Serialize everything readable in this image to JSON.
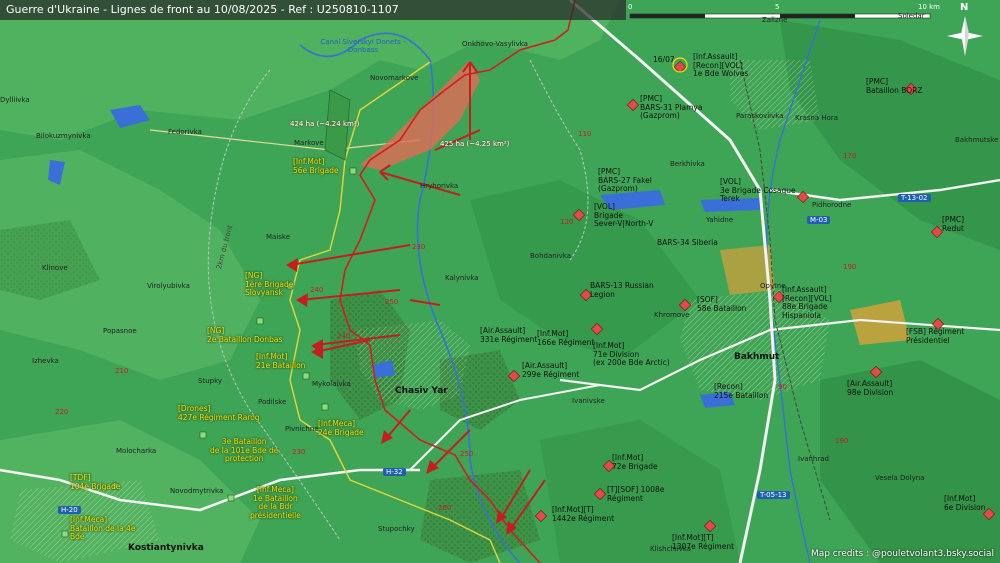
{
  "header": {
    "title": "Guerre d'Ukraine - Lignes de front au 10/08/2025 - Ref : U250810-1107"
  },
  "scale": {
    "labels": [
      "0",
      "5",
      "10 km"
    ]
  },
  "compass": {
    "label": "N"
  },
  "canal": {
    "label": "Canal Siverskyi Donets - Donbass"
  },
  "areas": {
    "west": "424 ha (~4.24 km²)",
    "east": "425 ha (~4.25 km²)"
  },
  "distances": {
    "2km": "2km du front"
  },
  "towns": {
    "chasiv_yar": "Chasiv Yar",
    "bakhmut": "Bakhmut",
    "kostiantynivka": "Kostiantynivka"
  },
  "places": [
    "Onkhovo-Vasylivka",
    "Novomarkove",
    "Markove",
    "Fedorivka",
    "Bilokuzmynivka",
    "Maiske",
    "Klinove",
    "Virolyubivka",
    "Popasnoe",
    "Izhevka",
    "Mykolaivka",
    "Stupochky",
    "Kalynivka",
    "Hryhorivka",
    "Bohdanivka",
    "Khromove",
    "Ivanivske",
    "Klishchiivka",
    "Paraskoviivka",
    "Yahidne",
    "Berkhivka",
    "Zalizne",
    "Soledar",
    "Krasna Hora",
    "Pidhorodne",
    "Bakhmutske",
    "Opytne",
    "Vesela Dolyna",
    "Ivanhrad",
    "Novodmytrivka",
    "Stupky",
    "Podilske",
    "Pivnichne",
    "Molocharka",
    "Dylliivka"
  ],
  "ru_units": {
    "assault_recon_vol": "[Inf.Assault]\n[Recon][VOL]\n1e Bde Wolves",
    "pmc_bars31": "[PMC]\nBARS-31 Plamya\n(Gazprom)",
    "pmc_bars27": "[PMC]\nBARS-27 Fakel\n(Gazprom)",
    "vol_3e": "[VOL]\n3e Brigade Cosaque\nTerek",
    "vol_sever": "[VOL]\nBrigade\nSever-V|North-V",
    "bars34": "BARS-34 Siberia",
    "bars13": "BARS-13 Russian\nLegion",
    "sof58": "[SOF]\n58e Bataillon",
    "assault88": "[Inf.Assault]\n[Recon][VOL]\n88e Brigade\nHispaniola",
    "pmc_borz": "[PMC]\nBataillon BORZ",
    "pmc_redut": "[PMC]\nRedut",
    "fsb": "[FSB] Régiment\nPrésidentiel",
    "assault331": "[Air.Assault]\n331e Régiment",
    "mot166": "[Inf.Mot]\n166e Régiment",
    "mot71": "[Inf.Mot]\n71e Division\n(ex 200e Bde Arctic)",
    "assault299": "[Air.Assault]\n299e Régiment",
    "recon215": "[Recon]\n215e Bataillon",
    "assault98": "[Air.Assault]\n98e Division",
    "mot72": "[Inf.Mot]\n72e Brigade",
    "sof1008": "[T][SOF] 1008e\nRégiment",
    "mot1442": "[Inf.Mot][T]\n1442e Régiment",
    "mot1307": "[Inf.Mot][T]\n1307e Régiment",
    "mot6": "[Inf.Mot]\n6e Division",
    "date_1607": "16/07"
  },
  "ua_units": {
    "mot56": "[Inf.Mot]\n56e Brigade",
    "ng1": "[NG]\n1ère Brigade\nSlovyansk",
    "ng2": "[NG]\n2e Bataillon Donbas",
    "mot21": "[Inf.Mot]\n21e Bataillon",
    "drones427": "[Drones]\n427e Régiment Rarog",
    "meca24": "[Inf.Meca]\n24e Brigade",
    "bn3": "3e Bataillon\nde la 101e Bde de\nprotection",
    "tdf104": "[TDF]\n104e Brigade",
    "meca1": "[Inf.Meca]\n1e Bataillon\nde la Bdr\nprésidentielle",
    "meca4": "[Inf.Meca]\nBataillon de la 4e\nBde"
  },
  "roads": {
    "h32": "H-32",
    "h20": "H-20",
    "m03": "M-03",
    "t1302": "T-13-02",
    "t0513": "T-05-13"
  },
  "elevations": [
    "240",
    "230",
    "250",
    "260",
    "170",
    "190",
    "110",
    "120",
    "190",
    "210",
    "220",
    "240",
    "250",
    "230",
    "90"
  ],
  "credits": "Map credits : @pouletvolant3.bsky.social"
}
